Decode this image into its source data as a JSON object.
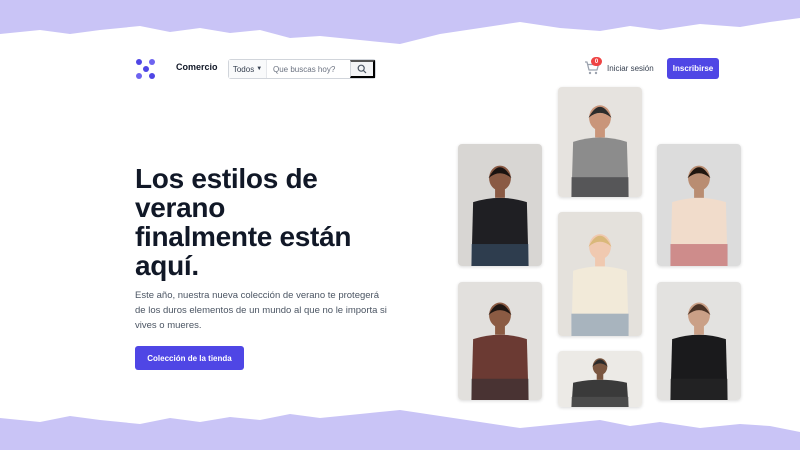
{
  "colors": {
    "accent": "#4f46e5",
    "wave": "#c9c4f6",
    "badge": "#ef4444"
  },
  "header": {
    "brand": "Comercio",
    "search": {
      "category": "Todos",
      "placeholder": "Que buscas hoy?"
    },
    "cart_count": "0",
    "login_label": "Iniciar sesión",
    "signup_label": "Inscribirse"
  },
  "hero": {
    "title_lines": [
      "Los estilos de",
      "verano",
      "finalmente están",
      "aquí."
    ],
    "description": "Este año, nuestra nueva colección de verano te protegerá de los duros elementos de un mundo al que no le importa si vives o mueres.",
    "cta_label": "Colección de la tienda"
  },
  "gallery": [
    {
      "name": "photo-woman-denim-jacket",
      "bg": "#d8d6d3",
      "shirt": "#1f1f23",
      "skin": "#8a5a44",
      "hair": "#1a1210",
      "accent": "#3b5673"
    },
    {
      "name": "photo-man-grey-tee",
      "bg": "#e6e3df",
      "shirt": "#8c8c8c",
      "skin": "#c9957a",
      "hair": "#2b2b2b",
      "accent": "#2a2a2e"
    },
    {
      "name": "photo-woman-cream-tee-denim",
      "bg": "#e4e1dc",
      "shirt": "#f2ead9",
      "skin": "#f0c9b0",
      "hair": "#d9b87a",
      "accent": "#6c86a8"
    },
    {
      "name": "photo-woman-printed-tee",
      "bg": "#dcdcdc",
      "shirt": "#f1dccb",
      "skin": "#b98d72",
      "hair": "#20160f",
      "accent": "#b04a58"
    },
    {
      "name": "photo-man-maroon-tee",
      "bg": "#e2e0dd",
      "shirt": "#6b3a33",
      "skin": "#8b5b43",
      "hair": "#1e1612",
      "accent": "#2d2d33"
    },
    {
      "name": "photo-man-beanie",
      "bg": "#eceae6",
      "shirt": "#3a3a3a",
      "skin": "#7a5640",
      "hair": "#2a2a2a",
      "accent": "#5a5a5a"
    },
    {
      "name": "photo-man-black-tee",
      "bg": "#e3e2e0",
      "shirt": "#1a1a1c",
      "skin": "#caa087",
      "hair": "#4a3326",
      "accent": "#2a2a2a"
    }
  ]
}
